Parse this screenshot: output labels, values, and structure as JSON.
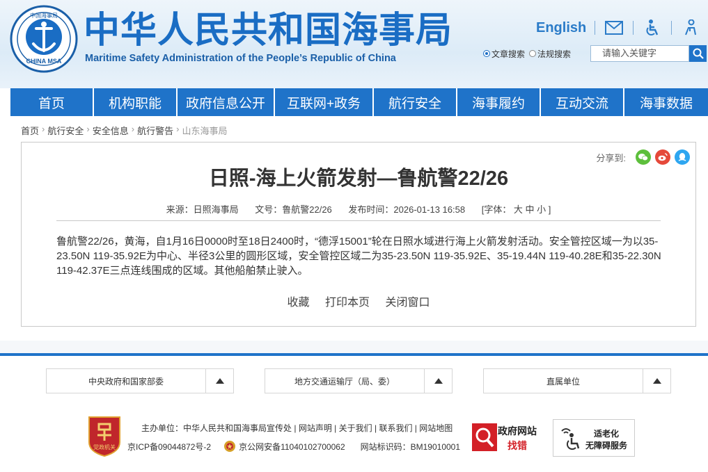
{
  "header": {
    "title_zh": "中华人民共和国海事局",
    "title_en": "Maritime Safety Administration of the People’s Republic of China",
    "logo_text_top": "中国海事局",
    "logo_text_bottom": "CHINA MSA",
    "english_link": "English",
    "search": {
      "option_article": "文章搜索",
      "option_law": "法规搜索",
      "placeholder": "请输入关键字"
    }
  },
  "nav": {
    "items": [
      {
        "label": "首页"
      },
      {
        "label": "机构职能"
      },
      {
        "label": "政府信息公开"
      },
      {
        "label": "互联网+政务"
      },
      {
        "label": "航行安全"
      },
      {
        "label": "海事履约"
      },
      {
        "label": "互动交流"
      },
      {
        "label": "海事数据"
      }
    ]
  },
  "breadcrumb": {
    "items": [
      "首页",
      "航行安全",
      "安全信息",
      "航行警告"
    ],
    "current": "山东海事局"
  },
  "article": {
    "share_label": "分享到:",
    "title": "日照-海上火箭发射—鲁航警22/26",
    "source": "来源：日照海事局",
    "doc_no": "文号：鲁航警22/26",
    "publish_time": "发布时间：2026-01-13 16:58",
    "font_size": "[字体：  大   中   小 ]",
    "body": "鲁航警22/26，黄海，自1月16日0000时至18日2400时，“德浮15001”轮在日照水域进行海上火箭发射活动。安全管控区域一为以35-23.50N 119-35.92E为中心、半径3公里的圆形区域，安全管控区域二为35-23.50N 119-35.92E、35-19.44N 119-40.28E和35-22.30N 119-42.37E三点连线围成的区域。其他船舶禁止驶入。",
    "actions": {
      "favorite": "收藏",
      "print": "打印本页",
      "close": "关闭窗口"
    }
  },
  "footer": {
    "dropdowns": [
      {
        "label": "中央政府和国家部委"
      },
      {
        "label": "地方交通运输厅（局、委）"
      },
      {
        "label": "直属单位"
      }
    ],
    "sponsor": "主办单位：中华人民共和国海事局宣传处",
    "links": [
      "网站声明",
      "关于我们",
      "联系我们",
      "网站地图"
    ],
    "icp": "京ICP备09044872号-2",
    "police": "京公网安备11040102700062",
    "site_id": "网站标识码：BM19010001",
    "party_badge_text": "党政机关",
    "gov_error_line1": "政府网站",
    "gov_error_line2": "找错",
    "access_line1": "适老化",
    "access_line2": "无障碍服务"
  },
  "colors": {
    "primary_blue": "#1f73c9",
    "title_blue": "#1a6dc4",
    "party_red": "#c0262b"
  }
}
